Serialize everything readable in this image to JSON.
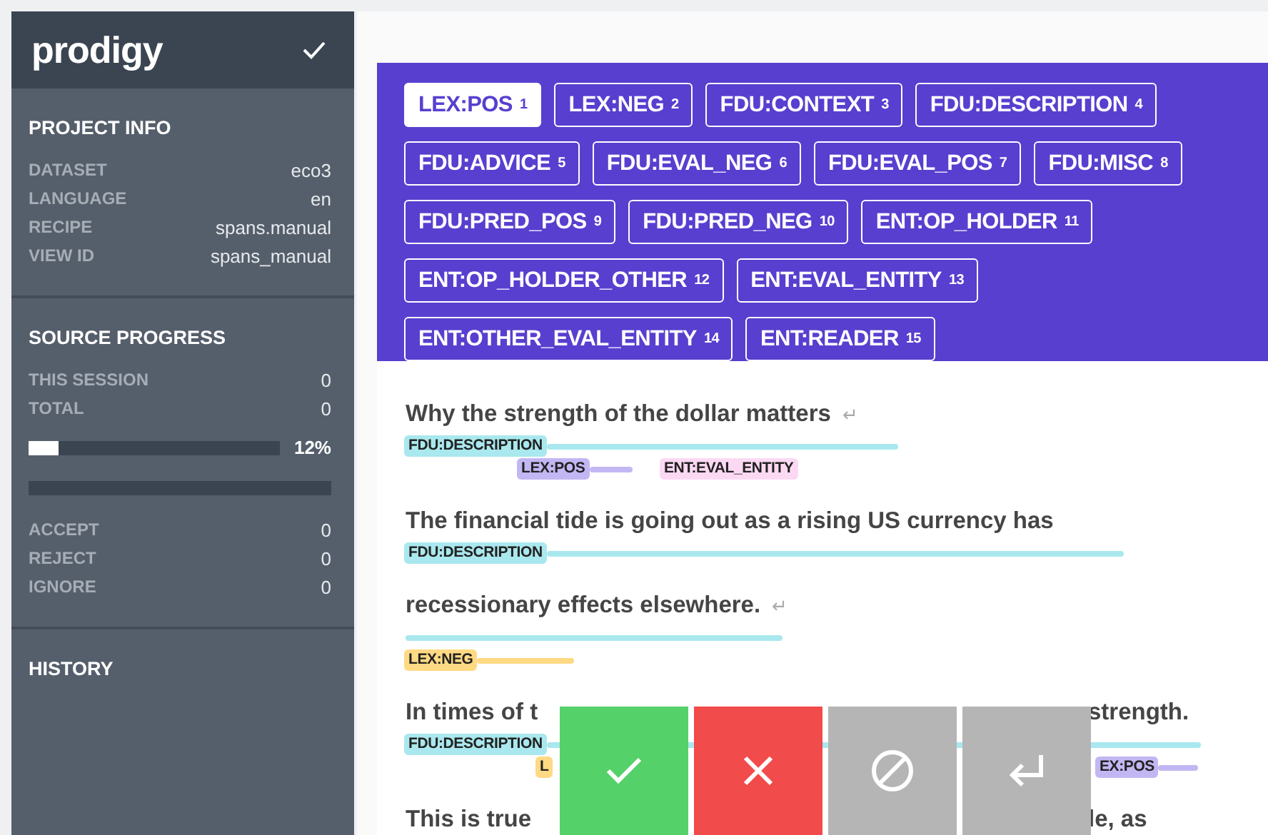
{
  "sidebar": {
    "logo": "prodigy",
    "project_info": {
      "title": "PROJECT INFO",
      "rows": [
        {
          "label": "DATASET",
          "value": "eco3"
        },
        {
          "label": "LANGUAGE",
          "value": "en"
        },
        {
          "label": "RECIPE",
          "value": "spans.manual"
        },
        {
          "label": "VIEW ID",
          "value": "spans_manual"
        }
      ]
    },
    "source_progress": {
      "title": "SOURCE PROGRESS",
      "rows": [
        {
          "label": "THIS SESSION",
          "value": "0"
        },
        {
          "label": "TOTAL",
          "value": "0"
        }
      ],
      "progress": {
        "level": 0.12,
        "reading": "12%"
      },
      "counts": [
        {
          "label": "ACCEPT",
          "value": "0"
        },
        {
          "label": "REJECT",
          "value": "0"
        },
        {
          "label": "IGNORE",
          "value": "0"
        }
      ]
    },
    "history": {
      "title": "HISTORY"
    }
  },
  "labels": [
    {
      "text": "LEX:POS",
      "key": "1",
      "selected": true
    },
    {
      "text": "LEX:NEG",
      "key": "2",
      "selected": false
    },
    {
      "text": "FDU:CONTEXT",
      "key": "3",
      "selected": false
    },
    {
      "text": "FDU:DESCRIPTION",
      "key": "4",
      "selected": false
    },
    {
      "text": "FDU:ADVICE",
      "key": "5",
      "selected": false
    },
    {
      "text": "FDU:EVAL_NEG",
      "key": "6",
      "selected": false
    },
    {
      "text": "FDU:EVAL_POS",
      "key": "7",
      "selected": false
    },
    {
      "text": "FDU:MISC",
      "key": "8",
      "selected": false
    },
    {
      "text": "FDU:PRED_POS",
      "key": "9",
      "selected": false
    },
    {
      "text": "FDU:PRED_NEG",
      "key": "10",
      "selected": false
    },
    {
      "text": "ENT:OP_HOLDER",
      "key": "11",
      "selected": false
    },
    {
      "text": "ENT:OP_HOLDER_OTHER",
      "key": "12",
      "selected": false
    },
    {
      "text": "ENT:EVAL_ENTITY",
      "key": "13",
      "selected": false
    },
    {
      "text": "ENT:OTHER_EVAL_ENTITY",
      "key": "14",
      "selected": false
    },
    {
      "text": "ENT:READER",
      "key": "15",
      "selected": false
    }
  ],
  "document": [
    {
      "parts": [
        "Why the strength of the dollar matters"
      ],
      "return_mark": "↵",
      "rows": [
        [
          {
            "label": "FDU:DESCRIPTION",
            "color": "#a9e8ee"
          }
        ],
        [
          {
            "label": "LEX:POS",
            "color": "#c3b7f3"
          },
          {
            "label": "ENT:EVAL_ENTITY",
            "color": "#fcd9f3"
          }
        ]
      ]
    },
    {
      "parts": [
        "The financial tide is going out as a rising US currency has"
      ],
      "rows": [
        [
          {
            "label": "FDU:DESCRIPTION",
            "color": "#a9e8ee"
          }
        ]
      ]
    },
    {
      "parts": [
        "recessionary effects elsewhere."
      ],
      "return_mark": "↵",
      "rows": [
        [
          {
            "color": "#a9e8ee"
          }
        ],
        [
          {
            "label": "LEX:NEG",
            "color": "#ffd983"
          }
        ]
      ]
    },
    {
      "parts": [
        "In times of t",
        "strength."
      ],
      "rows": [
        [
          {
            "label": "FDU:DESCRIPTION",
            "color": "#a9e8ee"
          }
        ],
        [
          {
            "label": "L",
            "color": "#ffd983"
          },
          {
            "label": "EX:POS",
            "color": "#c3b7f3"
          }
        ]
      ]
    },
    {
      "parts": [
        "This is true",
        "le, as"
      ]
    }
  ],
  "actions": [
    {
      "kind": "accept"
    },
    {
      "kind": "reject"
    },
    {
      "kind": "ignore"
    },
    {
      "kind": "undo"
    }
  ]
}
